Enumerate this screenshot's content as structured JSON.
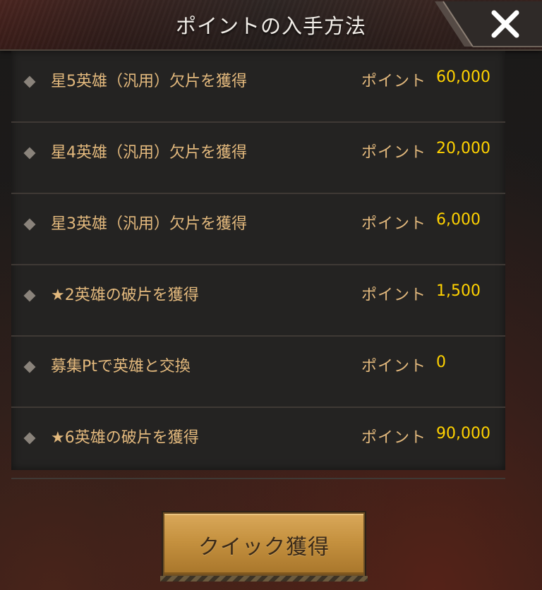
{
  "dialog": {
    "title": "ポイントの入手方法",
    "close_icon": "close-x-icon"
  },
  "rows": [
    {
      "label": "星5英雄（汎用）欠片を獲得",
      "points_label": "ポイント",
      "points_value": "60,000"
    },
    {
      "label": "星4英雄（汎用）欠片を獲得",
      "points_label": "ポイント",
      "points_value": "20,000"
    },
    {
      "label": "星3英雄（汎用）欠片を獲得",
      "points_label": "ポイント",
      "points_value": "6,000"
    },
    {
      "label": "★2英雄の破片を獲得",
      "points_label": "ポイント",
      "points_value": "1,500"
    },
    {
      "label": "募集Ptで英雄と交換",
      "points_label": "ポイント",
      "points_value": "0"
    },
    {
      "label": "★6英雄の破片を獲得",
      "points_label": "ポイント",
      "points_value": "90,000"
    }
  ],
  "footer": {
    "quick_button_label": "クイック獲得"
  },
  "colors": {
    "label_text": "#e3b97d",
    "points_value": "#ffd200",
    "button_gold": "#c5913f"
  }
}
